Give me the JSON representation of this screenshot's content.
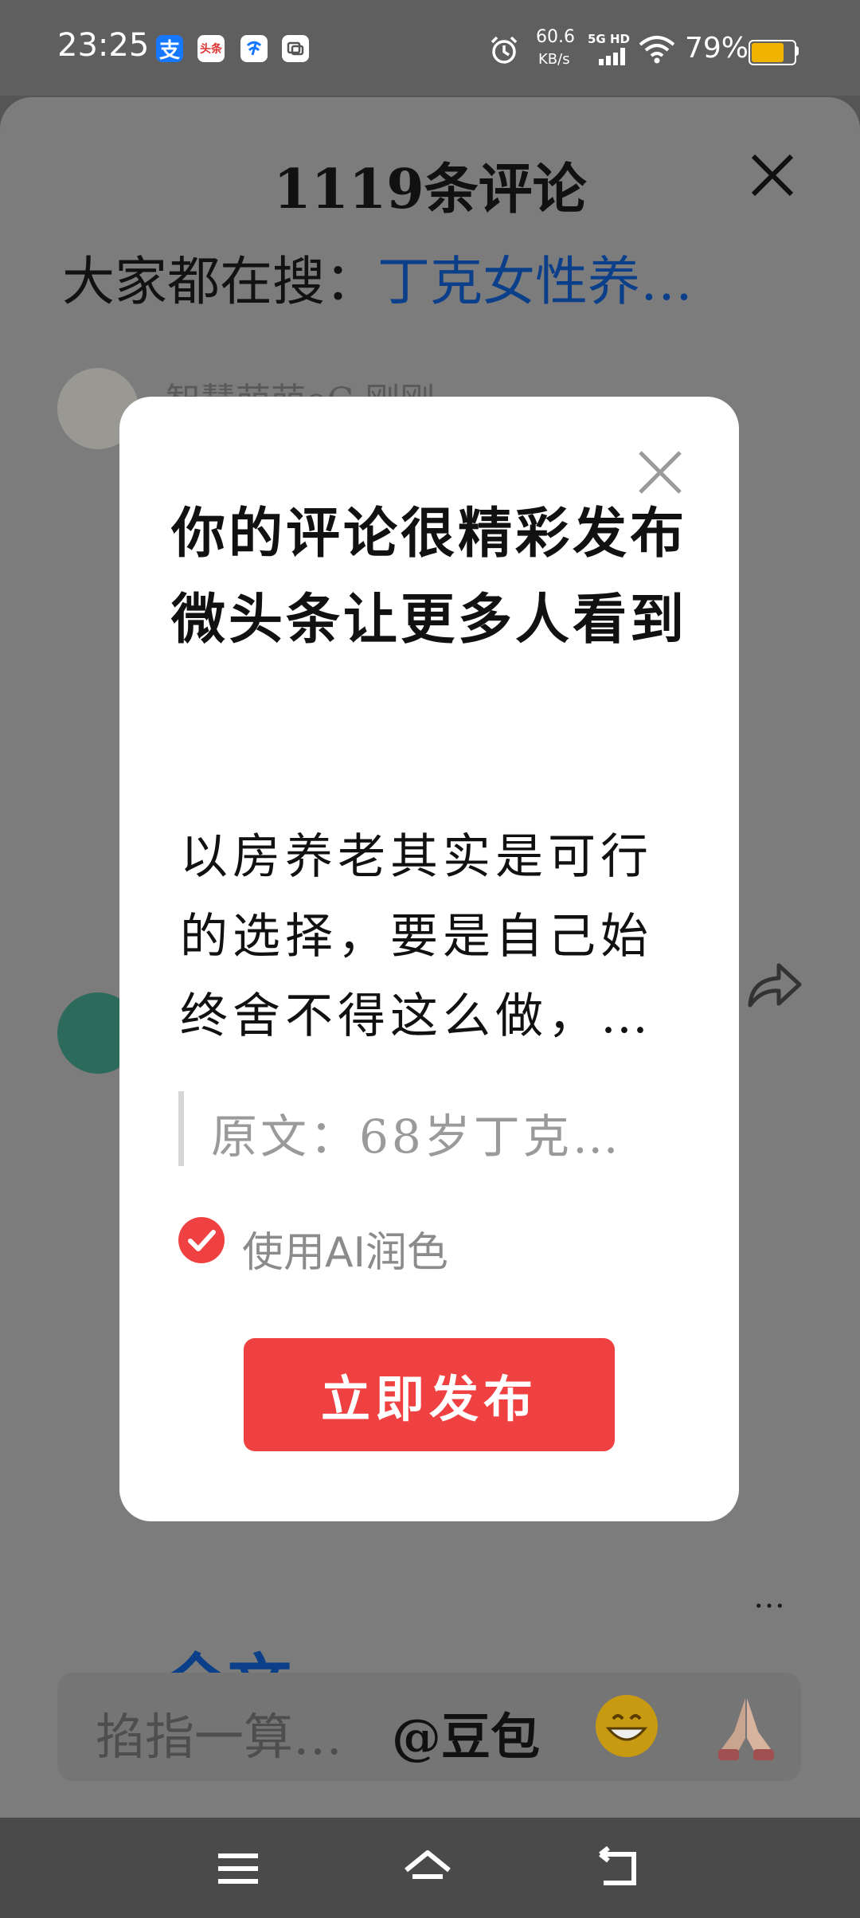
{
  "status_bar": {
    "time": "23:25",
    "net_speed_value": "60.6",
    "net_speed_unit": "KB/s",
    "network": "5G HD",
    "battery": "79%",
    "battery_level": 0.79,
    "app_icons": [
      "alipay-icon",
      "toutiao-icon",
      "telecom-icon",
      "message-icon"
    ],
    "toutiao_label": "头条"
  },
  "sheet": {
    "title": "1119条评论",
    "search_prefix": "大家都在搜：",
    "search_hot": "丁克女性养…",
    "commenter": "智慧萌萌oC 刚刚",
    "read_full": "全文",
    "more": "…"
  },
  "input_bar": {
    "placeholder": "掐指一算…",
    "mention": "@豆包",
    "emojis": [
      "grin-emoji",
      "pray-emoji"
    ]
  },
  "modal": {
    "title": "你的评论很精彩发布微头条让更多人看到",
    "body": "以房养老其实是可行的选择，要是自己始终舍不得这么做，…",
    "quote": "原文：68岁丁克…",
    "polish_label": "使用AI润色",
    "polish_checked": true,
    "publish_label": "立即发布"
  },
  "colors": {
    "accent_red": "#f04142",
    "link_blue": "#0b3f8a",
    "battery": "#f0b400"
  }
}
